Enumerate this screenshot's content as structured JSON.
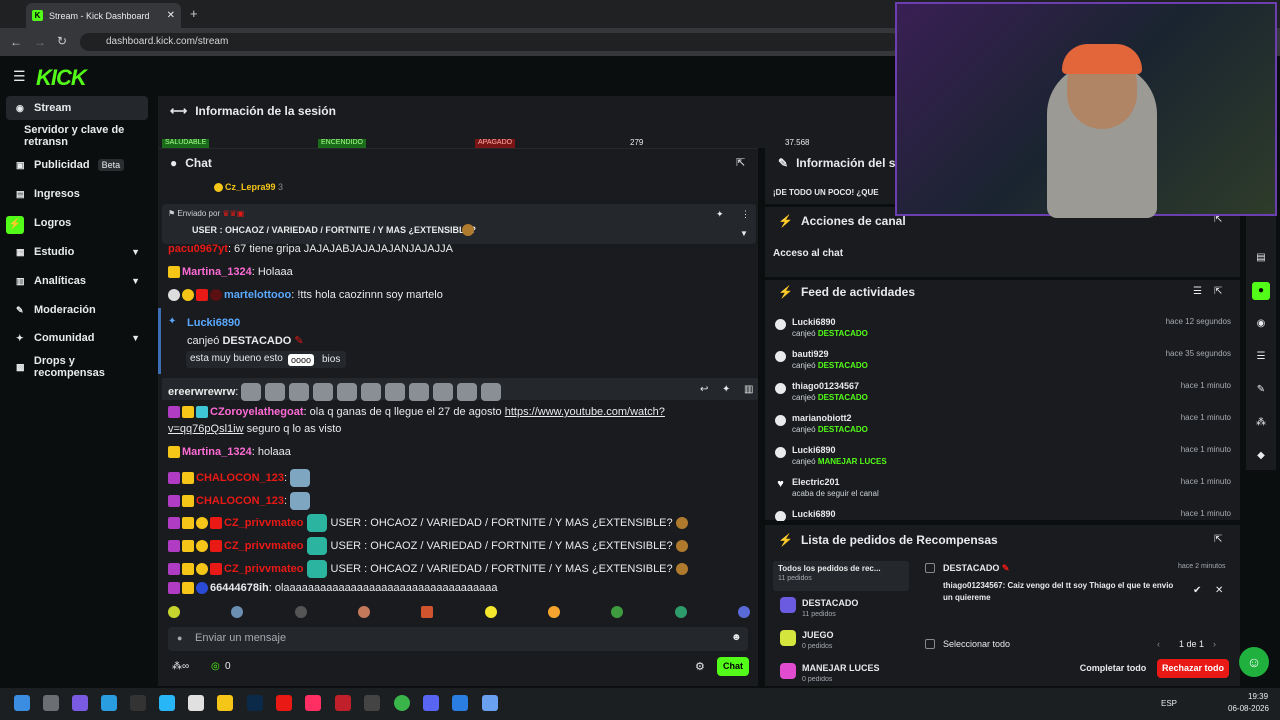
{
  "browser": {
    "tab_title": "Stream - Kick Dashboard",
    "url": "dashboard.kick.com/stream"
  },
  "app": {
    "logo": "KICK"
  },
  "sidebar": {
    "items": [
      {
        "label": "Stream",
        "icon": "broadcast-icon"
      },
      {
        "label": "Servidor y clave de retransn",
        "icon": ""
      },
      {
        "label": "Publicidad",
        "badge": "Beta",
        "icon": "megaphone-icon"
      },
      {
        "label": "Ingresos",
        "icon": "dollar-icon"
      },
      {
        "label": "Logros",
        "icon": "trophy-icon"
      },
      {
        "label": "Estudio",
        "icon": "layout-icon"
      },
      {
        "label": "Analíticas",
        "icon": "chart-icon"
      },
      {
        "label": "Moderación",
        "icon": "sword-icon"
      },
      {
        "label": "Comunidad",
        "icon": "users-icon"
      },
      {
        "label": "Drops y recompensas",
        "icon": "gift-icon"
      }
    ]
  },
  "session": {
    "title": "Información de la sesión",
    "stats": [
      "SALUDABLE",
      "ENCENDIDO",
      "APAGADO",
      "279",
      "37.568"
    ]
  },
  "chat": {
    "title": "Chat",
    "pinned_user": "Cz_Lepra99",
    "pinned_num": "3",
    "sent_by": "Enviado por",
    "pinned_msg": "USER : OHCAOZ / VARIEDAD / FORTNITE / Y MAS ¿EXTENSIBLE?",
    "messages": [
      {
        "user": "pacu0967yt",
        "text": ": 67 tiene gripa JAJAJABJAJAJAJANJAJAJJA",
        "color": "#e91916"
      },
      {
        "user": "Martina_1324",
        "text": ": Holaaa",
        "color": "#ff6bd5"
      },
      {
        "user": "martelottooo",
        "text": ": !tts hola caozinnn soy martelo",
        "color": "#5aa9ff"
      },
      {
        "user": "ereerwrewrw",
        "text": ":",
        "color": "#e8eaeb"
      },
      {
        "user": "CZoroyelathegoat",
        "text": ": ola q ganas de q llegue el 27 de agosto",
        "link": "https://www.youtube.com/watch?",
        "link2": "v=qq76pQsl1iw",
        "tail": "seguro q lo as visto",
        "color": "#ff6bd5"
      },
      {
        "user": "Martina_1324",
        "text": ": holaaa",
        "color": "#ff6bd5"
      },
      {
        "user": "CHALOCON_123",
        "text": ":",
        "color": "#e91916"
      },
      {
        "user": "CHALOCON_123",
        "text": ":",
        "color": "#e91916"
      },
      {
        "user": "CZ_privvmateo",
        "text": "USER : OHCAOZ / VARIEDAD / FORTNITE / Y MAS ¿EXTENSIBLE?",
        "color": "#e91916"
      },
      {
        "user": "CZ_privvmateo",
        "text": "USER : OHCAOZ / VARIEDAD / FORTNITE / Y MAS ¿EXTENSIBLE?",
        "color": "#e91916"
      },
      {
        "user": "CZ_privvmateo",
        "text": "USER : OHCAOZ / VARIEDAD / FORTNITE / Y MAS ¿EXTENSIBLE?",
        "color": "#e91916"
      },
      {
        "user": "66444678ih",
        "text": ": olaaaaaaaaaaaaaaaaaaaaaaaaaaaaaaaaaaa",
        "color": "#e8eaeb"
      }
    ],
    "redeem": {
      "user": "Lucki6890",
      "text": "canjeó",
      "reward": "DESTACADO",
      "quote": "esta muy bueno esto",
      "tooltip": "oooo",
      "quote_tail": "bios"
    },
    "input_placeholder": "Enviar un mensaje",
    "viewer_count": "0",
    "chat_button": "Chat"
  },
  "stream_info": {
    "title": "Información del str",
    "subtitle": "¡DE TODO UN POCO! ¿QUE"
  },
  "channel_actions": {
    "title": "Acciones de canal",
    "item": "Acceso al chat"
  },
  "feed": {
    "title": "Feed de actividades",
    "items": [
      {
        "user": "Lucki6890",
        "action": "canjeó",
        "reward": "DESTACADO",
        "time": "hace 12 segundos"
      },
      {
        "user": "bauti929",
        "action": "canjeó",
        "reward": "DESTACADO",
        "time": "hace 35 segundos"
      },
      {
        "user": "thiago01234567",
        "action": "canjeó",
        "reward": "DESTACADO",
        "time": "hace 1 minuto"
      },
      {
        "user": "marianobiott2",
        "action": "canjeó",
        "reward": "DESTACADO",
        "time": "hace 1 minuto"
      },
      {
        "user": "Lucki6890",
        "action": "canjeó",
        "reward": "MANEJAR LUCES",
        "time": "hace 1 minuto"
      },
      {
        "user": "Electric201",
        "action": "acaba de seguir el canal",
        "reward": "",
        "time": "hace 1 minuto"
      },
      {
        "user": "Lucki6890",
        "action": "",
        "reward": "",
        "time": "hace 1 minuto"
      }
    ]
  },
  "rewards": {
    "title": "Lista de pedidos de Recompensas",
    "all_label": "Todos los pedidos de rec...",
    "all_count": "11 pedidos",
    "categories": [
      {
        "name": "DESTACADO",
        "count": "11 pedidos"
      },
      {
        "name": "JUEGO",
        "count": "0 pedidos"
      },
      {
        "name": "MANEJAR LUCES",
        "count": "0 pedidos"
      }
    ],
    "request": {
      "reward": "DESTACADO",
      "time": "hace 2 minutos",
      "user": "thiago01234567:",
      "text": "Caiz vengo del tt soy Thiago el que te envio un quiereme"
    },
    "select_all": "Seleccionar todo",
    "page": "1 de 1",
    "complete_all": "Completar todo",
    "reject_all": "Rechazar todo"
  },
  "taskbar": {
    "lang": "ESP",
    "time": "19:39",
    "date": "06-08-2026"
  }
}
